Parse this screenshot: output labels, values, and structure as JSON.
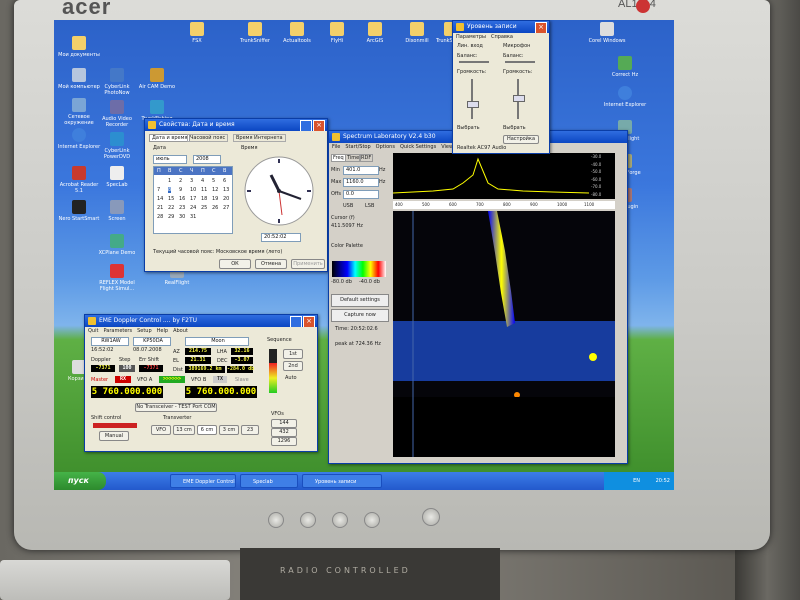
{
  "monitor": {
    "brand": "acer",
    "model": "AL1914",
    "base_label": "RADIO CONTROLLED"
  },
  "date_time": {
    "title": "Свойства: Дата и время",
    "tabs": [
      "Дата и время",
      "Часовой пояс",
      "Время Интернета"
    ],
    "date_group": "Дата",
    "time_group": "Время",
    "month": "июль",
    "year": "2008",
    "weekdays": [
      "П",
      "В",
      "С",
      "Ч",
      "П",
      "С",
      "В"
    ],
    "days": [
      "1",
      "2",
      "3",
      "4",
      "5",
      "6",
      "7",
      "8",
      "9",
      "10",
      "11",
      "12",
      "13",
      "14",
      "15",
      "16",
      "17",
      "18",
      "19",
      "20",
      "21",
      "22",
      "23",
      "24",
      "25",
      "26",
      "27",
      "28",
      "29",
      "30",
      "31"
    ],
    "time_value": "20:52:02",
    "timezone": "Текущий часовой пояс: Московское время (лето)",
    "ok": "ОК",
    "cancel": "Отмена",
    "apply": "Применить"
  },
  "eme": {
    "title": "EME Doppler Control .... by F2TU",
    "menu": [
      "Quit",
      "Parameters",
      "Setup",
      "Help",
      "About"
    ],
    "call": "RW1AW",
    "locator": "KP50DA",
    "moon": "Moon",
    "time": "16:52:02",
    "date": "08.07.2008",
    "doppler_label": "Doppler",
    "step_label": "Step",
    "shift_label": "Err Shift",
    "doppler": "-7371",
    "step": "100",
    "err_shift": "-7371",
    "az_label": "AZ",
    "az": "214.75",
    "lha_label": "LHA",
    "lha": "32.16",
    "el_label": "EL",
    "el": "21.31",
    "dec_label": "DEC",
    "dec": "-3.07",
    "dist_label": "Dist",
    "dist": "389169.2 km",
    "db": "-284.0 db",
    "master": "Master",
    "rx": "RX",
    "vfoa": "VFO A",
    "arrow": ">>>>>>",
    "vfob": "VFO B",
    "tx": "TX",
    "slave": "Slave",
    "freq_a": "5 760.000.000",
    "freq_b": "5 760.000.000",
    "no_trx": "No Transceiver - TEST Port COM",
    "shift_control": "Shift control",
    "manual": "Manual",
    "transverter": "Transverter",
    "bands": [
      "VFO",
      "13 cm",
      "6 cm",
      "3 cm",
      "23"
    ],
    "sequence": "Sequence",
    "seq": [
      "1st",
      "2nd"
    ],
    "auto": "Auto",
    "vfo_box": "VFOs",
    "vfo_list": [
      "144",
      "432",
      "1296"
    ]
  },
  "spectrum": {
    "title": "Spectrum Laboratory V2.4 b30",
    "menu": [
      "File",
      "Start/Stop",
      "Options",
      "Quick Settings",
      "View/Windows"
    ],
    "tabs": [
      "Freq",
      "Time",
      "RDF"
    ],
    "min_label": "Min",
    "min": "401.0",
    "max_label": "Max",
    "max": "1160.0",
    "offs_label": "Offs",
    "offs": "0.0",
    "hz": "Hz",
    "usb": "USB",
    "lsb": "LSB",
    "cursor_label": "Cursor (f)",
    "cursor": "411.5097 Hz",
    "palette": "Color Palette",
    "pal_min": "-80.0 db",
    "pal_max": "-40.0 db",
    "default": "Default settings",
    "capture": "Capture now",
    "time": "Time: 20:52:02.6",
    "peak": "peak at 724.36 Hz",
    "scale": [
      "400",
      "500",
      "600",
      "700",
      "800",
      "900",
      "1000",
      "1100"
    ],
    "db_scale": [
      "-30.0",
      "-40.0",
      "-50.0",
      "-60.0",
      "-70.0",
      "-80.0"
    ]
  },
  "volume": {
    "title": "Уровень записи",
    "menu": [
      "Параметры",
      "Справка"
    ],
    "ch1": "Лин. вход",
    "ch2": "Микрофон",
    "balance": "Баланс:",
    "loudness": "Громкость:",
    "select": "Выбрать",
    "settings": "Настройка",
    "device": "Realtek AC97 Audio"
  },
  "desktop_icons": [
    "Мои документы",
    "Мой компьютер",
    "Сетевое окружение",
    "Internet Explorer",
    "Acrobat Reader 5.1",
    "Nero StartSmart",
    "CyberLink PhotoNow",
    "Audio Video Recorder",
    "CyberLink PowerDVD",
    "Air CAM Demo",
    "TrunkFishing",
    "FSX",
    "Dixonmill",
    "Actualtools",
    "FlyHi",
    "ArcGIS",
    "TrunkSniffer",
    "TrunkShifter",
    "Screen",
    "SuperFlight",
    "XCPlane Demo",
    "Sound Forge",
    "SpecLab",
    "VST Plugin",
    "REFLEX Model Flight Simul...",
    "RealFlight",
    "Corel Windows",
    "Correct Hz",
    "Internet Explorer",
    "Корзина"
  ],
  "taskbar": {
    "start": "пуск",
    "tasks": [
      "EME Doppler Control ...",
      "Speclab",
      "Уровень записи"
    ],
    "lang": "EN",
    "clock": "20:52"
  }
}
